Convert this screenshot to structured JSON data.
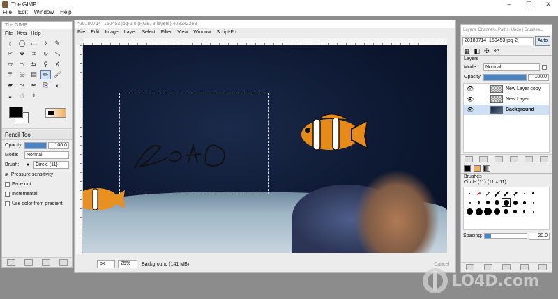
{
  "app": {
    "title": "The GIMP"
  },
  "menubar": [
    "File",
    "Edit",
    "Window",
    "Help"
  ],
  "window_controls": [
    "–",
    "☐",
    "✕"
  ],
  "toolbox": {
    "title": "The GIMP",
    "menu": [
      "File",
      "Xtns",
      "Help"
    ],
    "tool_options": {
      "title": "Pencil Tool",
      "opacity_label": "Opacity:",
      "opacity_value": "100.0",
      "mode_label": "Mode:",
      "mode_value": "Normal",
      "brush_label": "Brush:",
      "brush_value": "Circle (11)",
      "pressure_label": "Pressure sensitivity",
      "fade_label": "Fade out",
      "incremental_label": "Incremental",
      "gradient_label": "Use color from gradient"
    },
    "tools": [
      "lasso",
      "ellipse-select",
      "rect-select",
      "magic-wand",
      "bezier",
      "scissors",
      "move",
      "crop",
      "rotate",
      "scale",
      "shear",
      "perspective",
      "flip",
      "zoom",
      "measure",
      "text",
      "bucket-fill",
      "blend",
      "pencil",
      "paintbrush",
      "eraser",
      "airbrush",
      "ink",
      "clone",
      "convolve",
      "dodge",
      "smudge",
      "color-picker"
    ]
  },
  "image_window": {
    "title": "*20180714_150453.jpg-2.0 (RGB, 3 layers) 4032x2268",
    "menu": [
      "File",
      "Edit",
      "Image",
      "Layer",
      "Select",
      "Filter",
      "View",
      "Window",
      "Script-Fu"
    ],
    "unit": "px",
    "zoom": "25%",
    "status": "Background (141 MB)",
    "cancel_label": "Cancel"
  },
  "dock": {
    "title": "Layers, Channels, Paths, Undo | Brushes...",
    "image_select": "20180714_150453.jpg-2",
    "auto_label": "Auto",
    "layers_label": "Layers",
    "mode_label": "Mode:",
    "mode_value": "Normal",
    "opacity_label": "Opacity:",
    "opacity_value": "100.0",
    "layers": [
      {
        "name": "New Layer copy",
        "active": false
      },
      {
        "name": "New Layer",
        "active": false
      },
      {
        "name": "Background",
        "active": true
      }
    ],
    "brushes_label": "Brushes",
    "brush_name": "Circle (11) (11 × 11)",
    "spacing_label": "Spacing:",
    "spacing_value": "20.0"
  },
  "watermark": "LO4D.com"
}
